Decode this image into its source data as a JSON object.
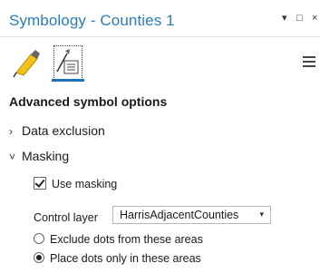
{
  "window": {
    "title": "Symbology - Counties 1",
    "buttons": {
      "dropdown_glyph": "▾",
      "restore_glyph": "□",
      "close_glyph": "×"
    }
  },
  "tabs": [
    {
      "icon": "paintbrush-icon",
      "active": false
    },
    {
      "icon": "symbol-options-icon",
      "active": true
    }
  ],
  "menu_icon": "hamburger-menu-icon",
  "section": {
    "heading": "Advanced symbol options"
  },
  "groups": {
    "data_exclusion": {
      "label": "Data exclusion",
      "expanded": false,
      "chevron": "›"
    },
    "masking": {
      "label": "Masking",
      "expanded": true,
      "chevron": "˅"
    }
  },
  "masking": {
    "use_masking": {
      "label": "Use masking",
      "checked": true
    },
    "control_layer": {
      "label": "Control layer",
      "value": "HarrisAdjacentCounties",
      "arrow": "▾"
    },
    "options": [
      {
        "label": "Exclude dots from these areas",
        "selected": false
      },
      {
        "label": "Place dots only in these areas",
        "selected": true
      }
    ]
  },
  "colors": {
    "title": "#2c7bbd",
    "active_tab_underline": "#1e6fbf",
    "brush_yellow": "#f2c21b"
  }
}
